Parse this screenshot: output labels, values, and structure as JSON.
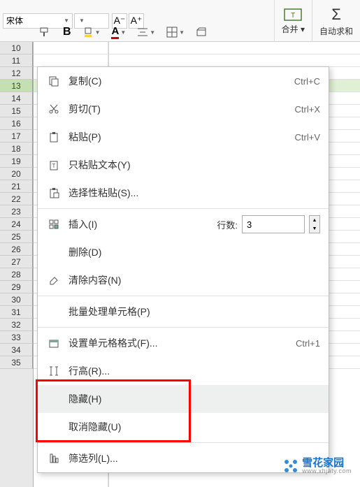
{
  "toolbar": {
    "font_name": "宋体",
    "decrease_font": "A⁻",
    "increase_font": "A⁺",
    "bold": "B",
    "merge_label": "合并 ▾",
    "autosum_label": "自动求和"
  },
  "rows": [
    10,
    11,
    12,
    13,
    14,
    15,
    16,
    17,
    18,
    19,
    20,
    21,
    22,
    23,
    24,
    25,
    26,
    27,
    28,
    29,
    30,
    31,
    32,
    33,
    34,
    35
  ],
  "selected_row": 13,
  "menu": {
    "copy": {
      "label": "复制(C)",
      "shortcut": "Ctrl+C"
    },
    "cut": {
      "label": "剪切(T)",
      "shortcut": "Ctrl+X"
    },
    "paste": {
      "label": "粘贴(P)",
      "shortcut": "Ctrl+V"
    },
    "paste_text": {
      "label": "只粘贴文本(Y)"
    },
    "paste_special": {
      "label": "选择性粘贴(S)..."
    },
    "insert": {
      "label": "插入(I)",
      "rows_label": "行数:",
      "rows_value": "3"
    },
    "delete": {
      "label": "删除(D)"
    },
    "clear": {
      "label": "清除内容(N)"
    },
    "batch": {
      "label": "批量处理单元格(P)"
    },
    "format": {
      "label": "设置单元格格式(F)...",
      "shortcut": "Ctrl+1"
    },
    "row_height": {
      "label": "行高(R)..."
    },
    "hide": {
      "label": "隐藏(H)"
    },
    "unhide": {
      "label": "取消隐藏(U)"
    },
    "filter": {
      "label": "筛选列(L)..."
    }
  },
  "watermark": {
    "main": "雪花家园",
    "sub": "www.xhjaty.com"
  }
}
